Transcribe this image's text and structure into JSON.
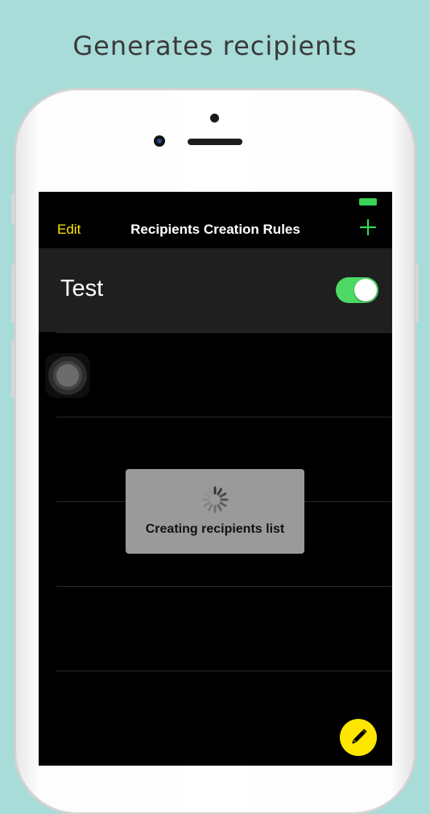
{
  "headline": "Generates recipients",
  "navbar": {
    "edit_label": "Edit",
    "title": "Recipients Creation Rules",
    "add_icon": "plus-icon"
  },
  "rules": [
    {
      "name": "Test",
      "enabled": true
    }
  ],
  "loading": {
    "message": "Creating recipients list",
    "icon": "spinner-icon"
  },
  "fab": {
    "icon": "pencil-icon"
  },
  "colors": {
    "accent_yellow": "#ffe600",
    "accent_green": "#2ee05c",
    "toggle_on": "#4cd964",
    "background": "#a8dcd8"
  }
}
